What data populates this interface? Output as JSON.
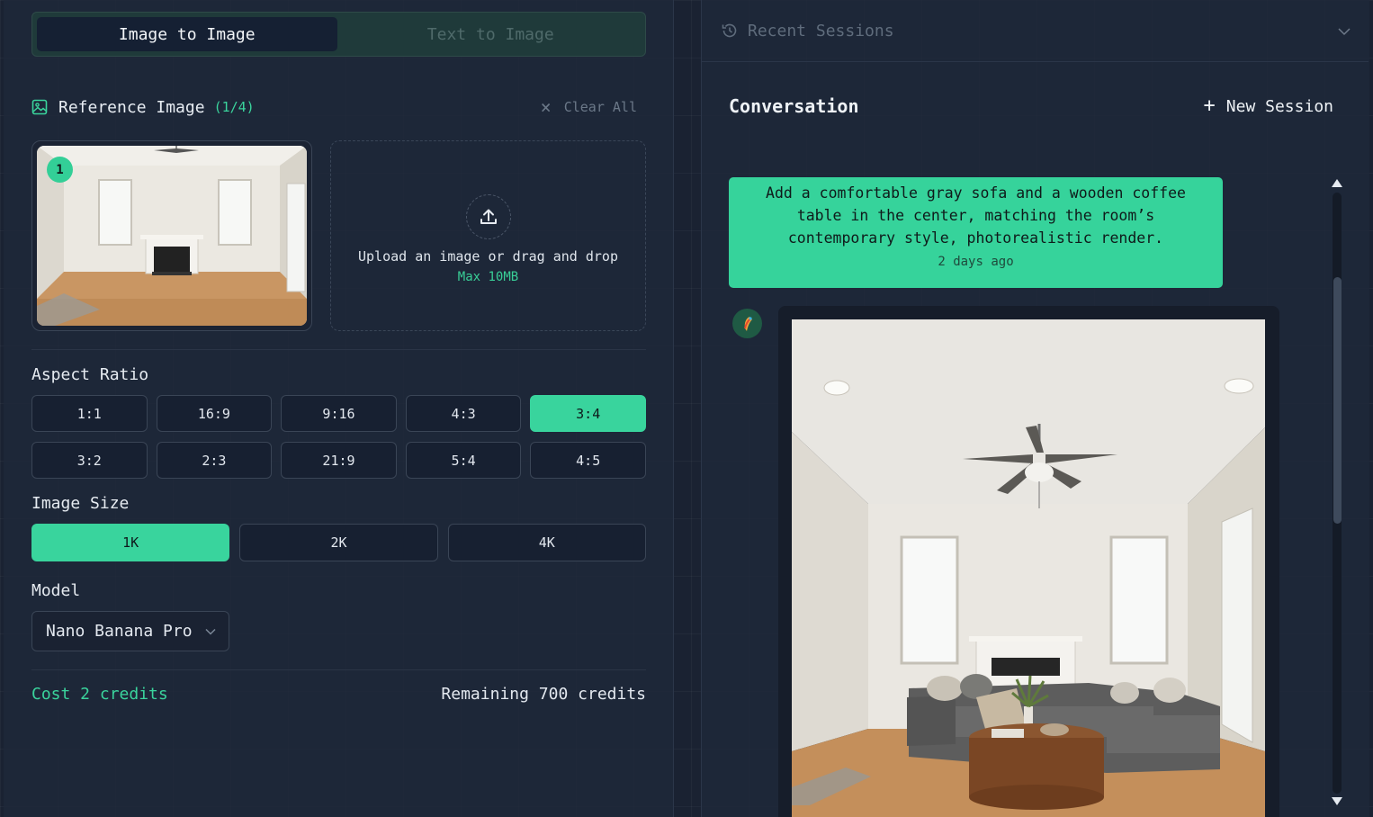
{
  "mode_tabs": {
    "image_to_image": "Image to Image",
    "text_to_image": "Text to Image"
  },
  "reference": {
    "title": "Reference Image",
    "count": "(1/4)",
    "clear_all": "Clear All",
    "thumb_number": "1",
    "upload_text": "Upload an image or drag and drop",
    "upload_limit": "Max 10MB"
  },
  "aspect_ratio": {
    "label": "Aspect Ratio",
    "selected": "3:4",
    "options": [
      "1:1",
      "16:9",
      "9:16",
      "4:3",
      "3:4",
      "3:2",
      "2:3",
      "21:9",
      "5:4",
      "4:5"
    ]
  },
  "image_size": {
    "label": "Image Size",
    "selected": "1K",
    "options": [
      "1K",
      "2K",
      "4K"
    ]
  },
  "model": {
    "label": "Model",
    "value": "Nano Banana Pro"
  },
  "credits": {
    "cost": "Cost 2 credits",
    "remaining": "Remaining 700 credits"
  },
  "right": {
    "recent_sessions": "Recent Sessions",
    "conversation_title": "Conversation",
    "new_session": "New Session",
    "message": {
      "text": "Add a comfortable gray sofa and a wooden coffee table in the center, matching the room’s contemporary style, photorealistic render.",
      "time": "2 days ago"
    }
  },
  "colors": {
    "accent": "#39d49d",
    "panel": "#1e2839",
    "background": "#1a2232"
  },
  "icons": [
    "image-icon",
    "close-icon",
    "upload-icon",
    "history-icon",
    "chevron-down-icon",
    "plus-icon",
    "parrot-avatar-icon"
  ]
}
